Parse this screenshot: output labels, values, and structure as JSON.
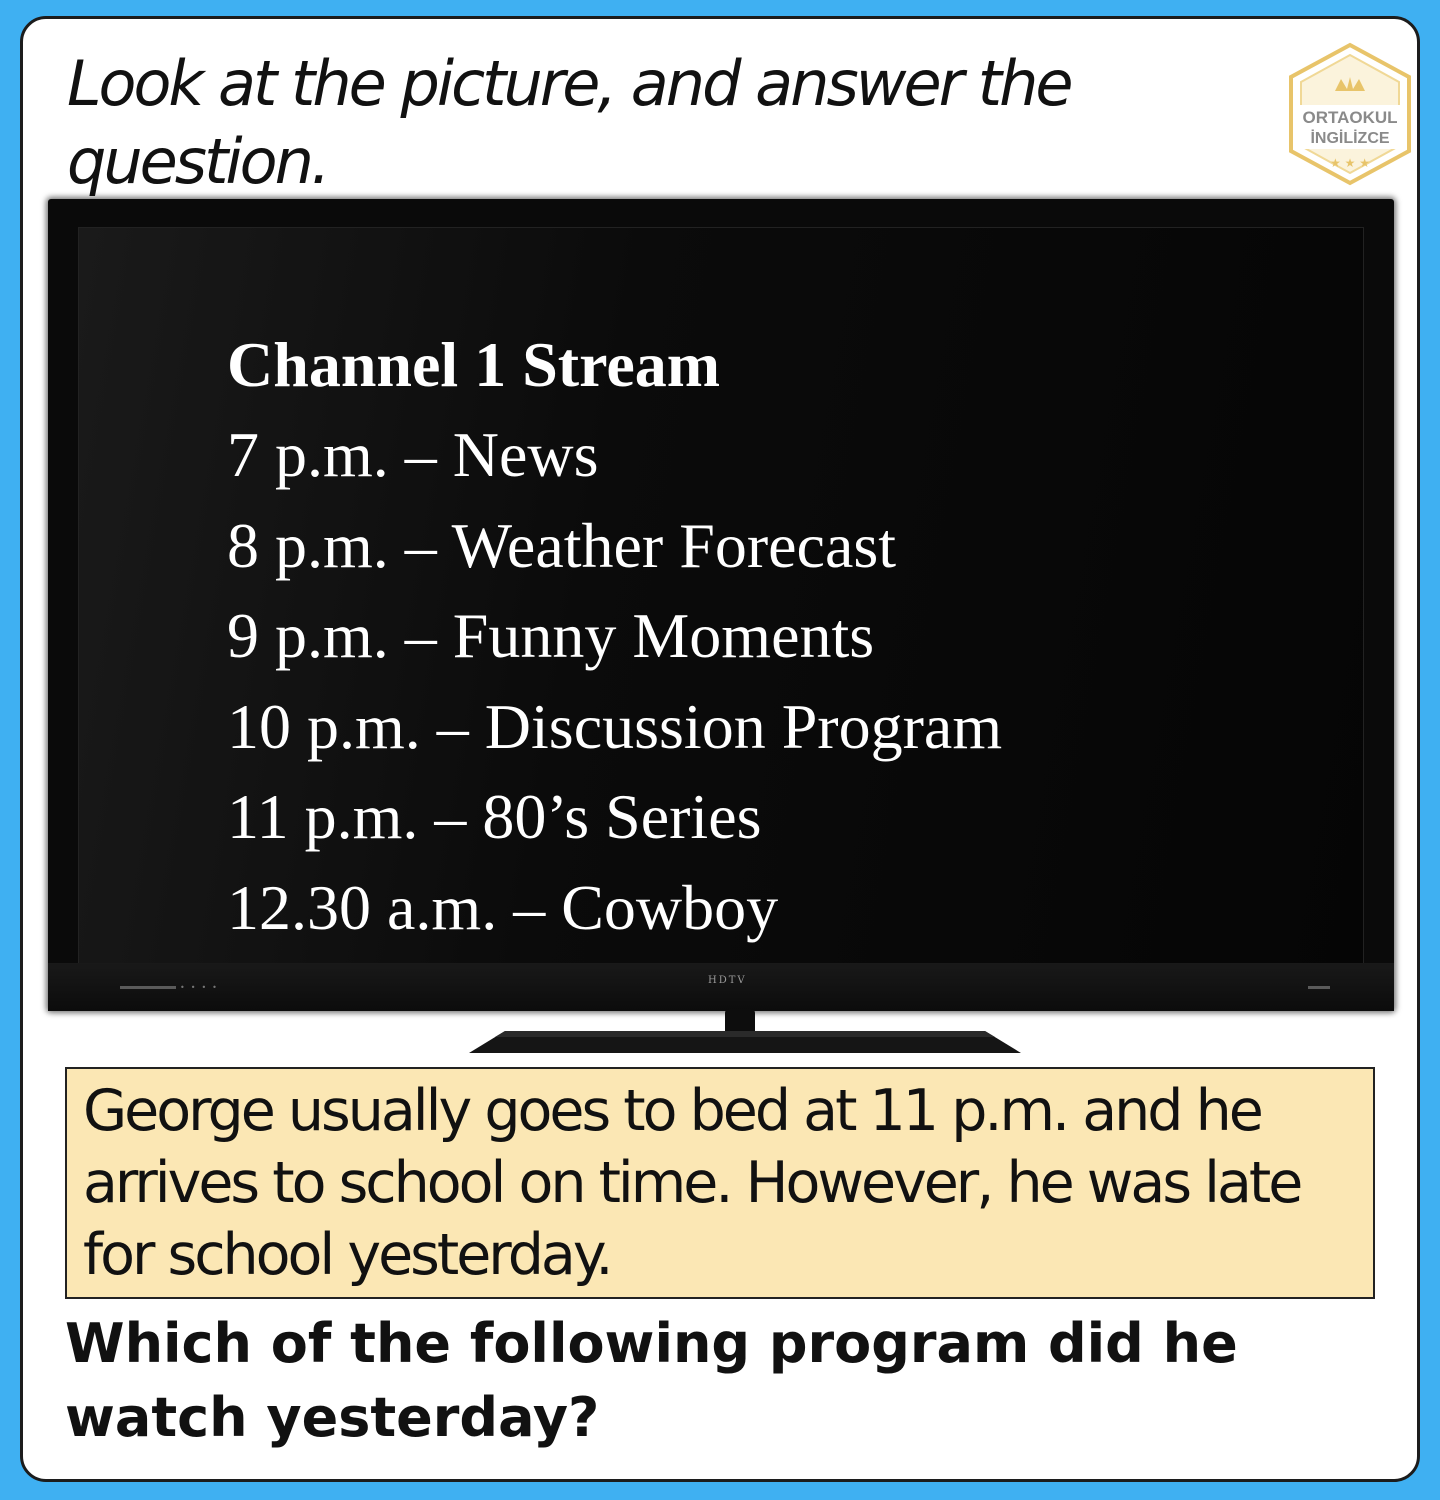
{
  "instruction": "Look at the picture, and answer the question.",
  "logo": {
    "line1": "ORTAOKUL",
    "line2": "İNGİLİZCE",
    "icon": "crown-shield-icon",
    "color": "#e8c46a"
  },
  "tv": {
    "brand": "HDTV",
    "channel_title": "Channel 1 Stream",
    "schedule": [
      {
        "time": "7 p.m.",
        "program": "News"
      },
      {
        "time": "8 p.m.",
        "program": "Weather Forecast"
      },
      {
        "time": "9 p.m.",
        "program": "Funny Moments"
      },
      {
        "time": "10 p.m.",
        "program": "Discussion Program"
      },
      {
        "time": "11 p.m.",
        "program": "80’s Series"
      },
      {
        "time": "12.30 a.m.",
        "program": "Cowboy"
      }
    ]
  },
  "context": "George usually goes to bed at 11 p.m. and he arrives to school on time. However, he was late for school yesterday.",
  "question": "Which of the following program did he watch yesterday?",
  "colors": {
    "background": "#3fb0f2",
    "card": "#ffffff",
    "context_box": "#fbe7b4"
  }
}
